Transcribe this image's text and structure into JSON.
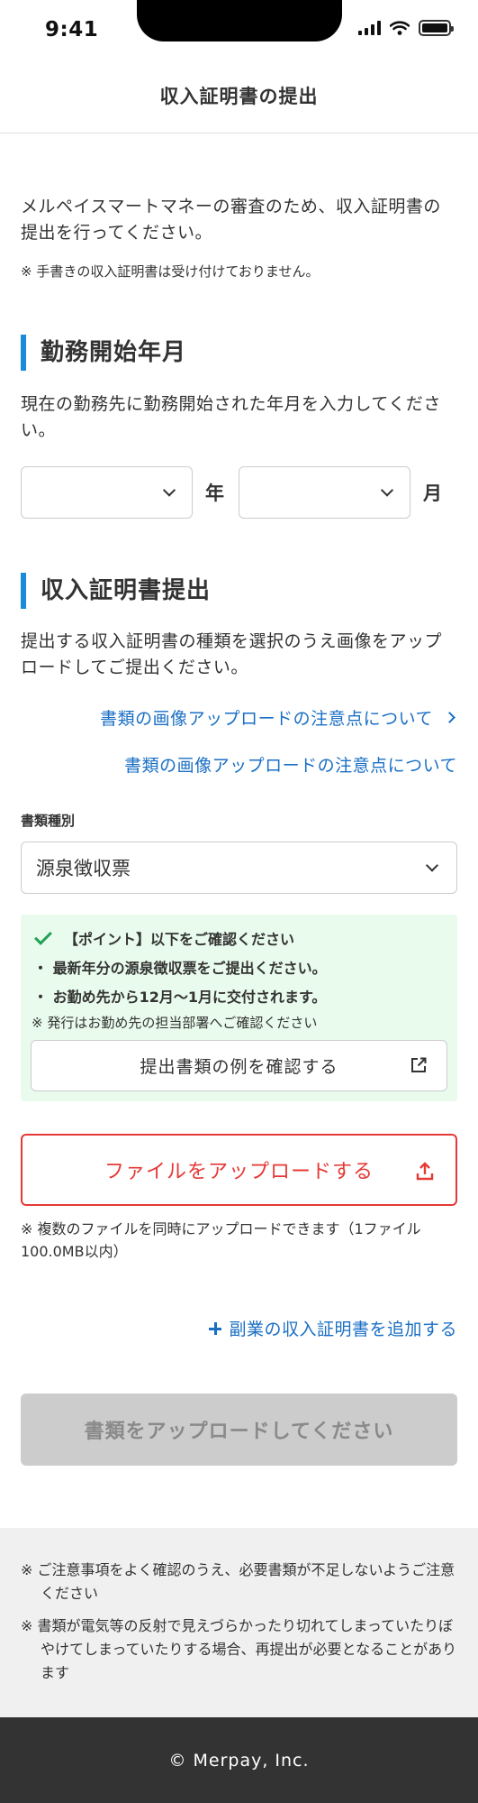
{
  "status_bar": {
    "time": "9:41"
  },
  "header": {
    "title": "収入証明書の提出"
  },
  "intro": {
    "text": "メルペイスマートマネーの審査のため、収入証明書の提出を行ってください。",
    "note": "※ 手書きの収入証明書は受け付けておりません。"
  },
  "employment": {
    "heading": "勤務開始年月",
    "description": "現在の勤務先に勤務開始された年月を入力してください。",
    "year_suffix": "年",
    "month_suffix": "月",
    "year_value": "",
    "month_value": ""
  },
  "income": {
    "heading": "収入証明書提出",
    "description": "提出する収入証明書の種類を選択のうえ画像をアップロードしてご提出ください。",
    "link_with_arrow": "書類の画像アップロードの注意点について",
    "link_plain": "書類の画像アップロードの注意点について",
    "doc_type_label": "書類種別",
    "doc_type_value": "源泉徴収票"
  },
  "point": {
    "title": "【ポイント】以下をご確認ください",
    "bullets": [
      "・ 最新年分の源泉徴収票をご提出ください。",
      "・ お勤め先から12月〜1月に交付されます。"
    ],
    "note": "※ 発行はお勤め先の担当部署へご確認ください",
    "example_button": "提出書類の例を確認する"
  },
  "upload": {
    "button": "ファイルをアップロードする",
    "note": "※ 複数のファイルを同時にアップロードできます（1ファイル100.0MB以内）"
  },
  "add_link": "副業の収入証明書を追加する",
  "submit_button": "書類をアップロードしてください",
  "footer_notes": [
    "※ ご注意事項をよく確認のうえ、必要書類が不足しないようご注意ください",
    "※ 書類が電気等の反射で見えづらかったり切れてしまっていたりぼやけてしまっていたりする場合、再提出が必要となることがあります"
  ],
  "footer": {
    "copyright": "© Merpay, Inc."
  },
  "colors": {
    "accent_blue": "#1a8bdb",
    "link_blue": "#1a6fc4",
    "danger_red": "#e53935",
    "success_green": "#23a053",
    "point_bg": "#e9fbec",
    "footer_bg": "#333333"
  }
}
